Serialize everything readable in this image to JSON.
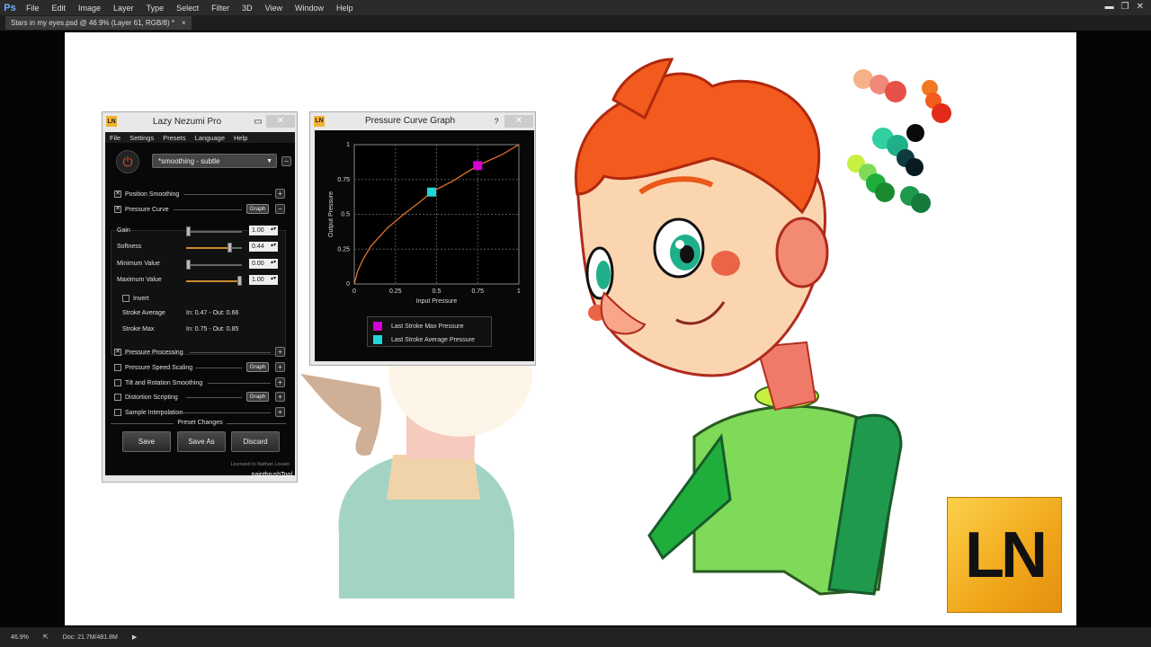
{
  "photoshop": {
    "logo": "Ps",
    "menu": [
      "File",
      "Edit",
      "Image",
      "Layer",
      "Type",
      "Select",
      "Filter",
      "3D",
      "View",
      "Window",
      "Help"
    ],
    "doc_tab": "Stars in my eyes.psd @ 46.9% (Layer 61, RGB/8) *",
    "doc_close": "×",
    "status_zoom": "46.9%",
    "status_doc": "Doc: 21.7M/481.8M"
  },
  "lazy_nezumi": {
    "badge": "LN",
    "title": "Lazy Nezumi Pro",
    "menu": [
      "File",
      "Settings",
      "Presets",
      "Language",
      "Help"
    ],
    "preset": "*smoothing - subtle",
    "rows": {
      "position_smoothing": "Position Smoothing",
      "pressure_curve": "Pressure Curve",
      "pressure_processing": "Pressure Processing",
      "pressure_speed_scaling": "Pressure Speed Scaling",
      "tilt_rotation": "Tilt and Rotation Smoothing",
      "distortion_scripting": "Distortion Scripting",
      "sample_interpolation": "Sample Interpolation"
    },
    "graph_label": "Graph",
    "sliders": {
      "gain": {
        "label": "Gain",
        "value": "1.00",
        "level": 0.0
      },
      "softness": {
        "label": "Softness",
        "value": "0.44",
        "level": 0.8
      },
      "minimum": {
        "label": "Minimum Value",
        "value": "0.00",
        "level": 0.0
      },
      "maximum": {
        "label": "Maximum Value",
        "value": "1.00",
        "level": 1.0
      }
    },
    "invert": "Invert",
    "stroke_average_label": "Stroke Average",
    "stroke_average_value": "In: 0.47 - Out: 0.66",
    "stroke_max_label": "Stroke Max",
    "stroke_max_value": "In: 0.75 - Out: 0.85",
    "preset_changes": "Preset Changes",
    "save": "Save",
    "save_as": "Save As",
    "discard": "Discard",
    "license": "Licensed to Nathan Lovato",
    "app": "paintbrushTool"
  },
  "pressure_graph": {
    "badge": "LN",
    "title": "Pressure Curve Graph",
    "help": "?",
    "legend_max": "Last Stroke Max Pressure",
    "legend_avg": "Last Stroke Average Pressure",
    "colors": {
      "max": "#d400d4",
      "avg": "#1fd6d6",
      "curve": "#e0702c"
    }
  },
  "chart_data": {
    "type": "line",
    "title": "",
    "xlabel": "Input Pressure",
    "ylabel": "Output Pressure",
    "xlim": [
      0,
      1
    ],
    "ylim": [
      0,
      1
    ],
    "x_ticks": [
      "0",
      "0.25",
      "0.5",
      "0.75",
      "1"
    ],
    "y_ticks": [
      "0",
      "0.25",
      "0.5",
      "0.75",
      "1"
    ],
    "grid": true,
    "series": [
      {
        "x": [
          0,
          0.02,
          0.05,
          0.1,
          0.2,
          0.3,
          0.4,
          0.47,
          0.6,
          0.75,
          0.9,
          1
        ],
        "y": [
          0,
          0.09,
          0.17,
          0.27,
          0.4,
          0.5,
          0.59,
          0.66,
          0.74,
          0.85,
          0.93,
          1
        ]
      }
    ],
    "points": [
      {
        "name": "Last Stroke Max Pressure",
        "x": 0.75,
        "y": 0.85
      },
      {
        "name": "Last Stroke Average Pressure",
        "x": 0.47,
        "y": 0.66
      }
    ]
  },
  "logo_text": "LN"
}
